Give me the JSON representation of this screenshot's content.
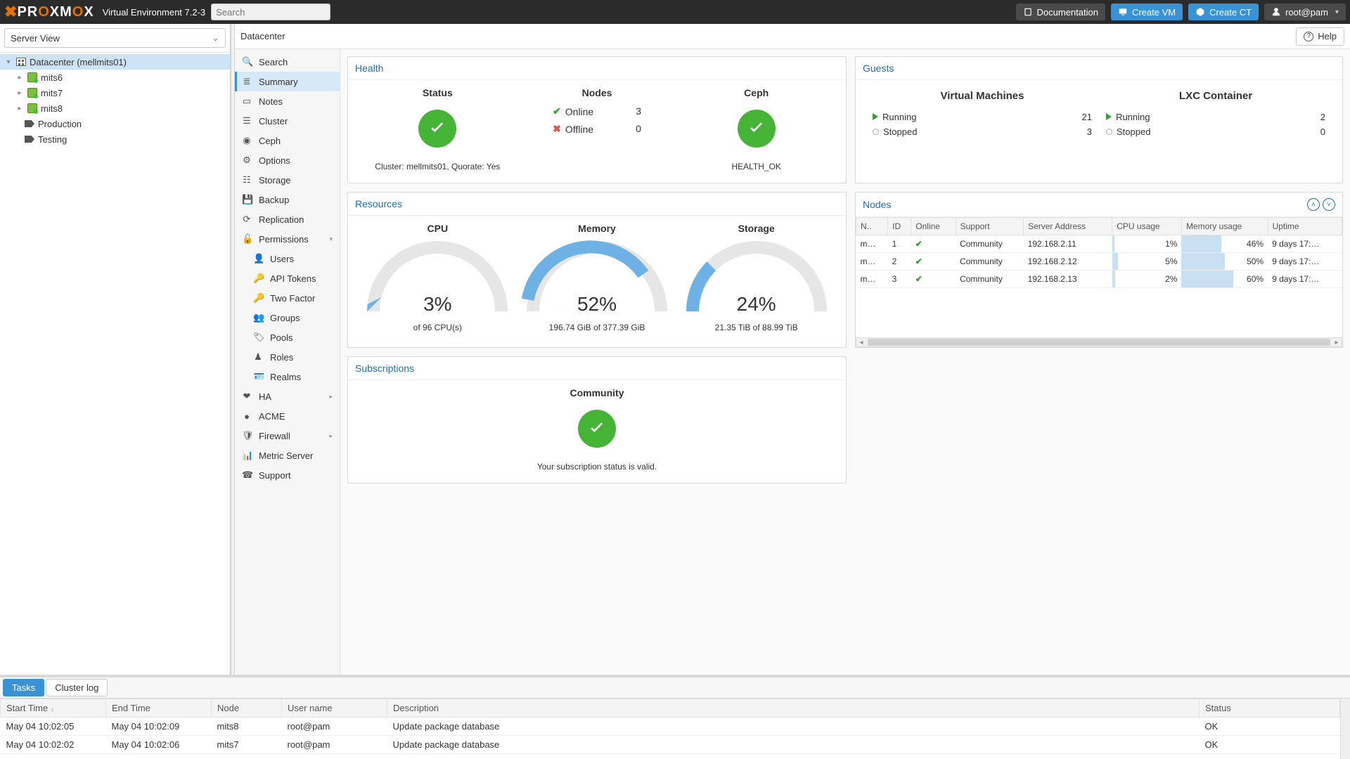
{
  "app": {
    "product": "PROXMOX",
    "subtitle": "Virtual Environment 7.2-3"
  },
  "search": {
    "placeholder": "Search"
  },
  "topbar": {
    "documentation": "Documentation",
    "create_vm": "Create VM",
    "create_ct": "Create CT",
    "user": "root@pam"
  },
  "tree": {
    "view_label": "Server View",
    "root": "Datacenter (mellmits01)",
    "nodes": [
      "mits6",
      "mits7",
      "mits8"
    ],
    "pools": [
      "Production",
      "Testing"
    ]
  },
  "crumb": {
    "title": "Datacenter",
    "help": "Help"
  },
  "menu": {
    "search": "Search",
    "summary": "Summary",
    "notes": "Notes",
    "cluster": "Cluster",
    "ceph": "Ceph",
    "options": "Options",
    "storage": "Storage",
    "backup": "Backup",
    "replication": "Replication",
    "permissions": "Permissions",
    "users": "Users",
    "api_tokens": "API Tokens",
    "two_factor": "Two Factor",
    "groups": "Groups",
    "pools": "Pools",
    "roles": "Roles",
    "realms": "Realms",
    "ha": "HA",
    "acme": "ACME",
    "firewall": "Firewall",
    "metric": "Metric Server",
    "support": "Support"
  },
  "health": {
    "title": "Health",
    "status_h": "Status",
    "nodes_h": "Nodes",
    "ceph_h": "Ceph",
    "cluster_line": "Cluster: mellmits01, Quorate: Yes",
    "online_l": "Online",
    "online_v": "3",
    "offline_l": "Offline",
    "offline_v": "0",
    "ceph_status": "HEALTH_OK"
  },
  "guests": {
    "title": "Guests",
    "vm_h": "Virtual Machines",
    "lxc_h": "LXC Container",
    "running_l": "Running",
    "stopped_l": "Stopped",
    "vm_running": "21",
    "vm_stopped": "3",
    "lxc_running": "2",
    "lxc_stopped": "0"
  },
  "resources": {
    "title": "Resources",
    "cpu_h": "CPU",
    "cpu_v": "3%",
    "cpu_sub": "of 96 CPU(s)",
    "mem_h": "Memory",
    "mem_v": "52%",
    "mem_sub": "196.74 GiB of 377.39 GiB",
    "sto_h": "Storage",
    "sto_v": "24%",
    "sto_sub": "21.35 TiB of 88.99 TiB"
  },
  "nodes_panel": {
    "title": "Nodes",
    "cols": {
      "name": "N..",
      "id": "ID",
      "online": "Online",
      "support": "Support",
      "addr": "Server Address",
      "cpu": "CPU usage",
      "mem": "Memory usage",
      "uptime": "Uptime"
    },
    "rows": [
      {
        "name": "m…",
        "id": "1",
        "support": "Community",
        "addr": "192.168.2.11",
        "cpu": "1%",
        "cpu_p": 3,
        "mem": "46%",
        "mem_p": 46,
        "uptime": "9 days 17:…"
      },
      {
        "name": "m…",
        "id": "2",
        "support": "Community",
        "addr": "192.168.2.12",
        "cpu": "5%",
        "cpu_p": 8,
        "mem": "50%",
        "mem_p": 50,
        "uptime": "9 days 17:…"
      },
      {
        "name": "m…",
        "id": "3",
        "support": "Community",
        "addr": "192.168.2.13",
        "cpu": "2%",
        "cpu_p": 4,
        "mem": "60%",
        "mem_p": 60,
        "uptime": "9 days 17:…"
      }
    ]
  },
  "subs": {
    "title": "Subscriptions",
    "level": "Community",
    "msg": "Your subscription status is valid."
  },
  "log": {
    "tabs": {
      "tasks": "Tasks",
      "cluster": "Cluster log"
    },
    "cols": {
      "start": "Start Time",
      "end": "End Time",
      "node": "Node",
      "user": "User name",
      "desc": "Description",
      "status": "Status"
    },
    "rows": [
      {
        "start": "May 04 10:02:05",
        "end": "May 04 10:02:09",
        "node": "mits8",
        "user": "root@pam",
        "desc": "Update package database",
        "status": "OK"
      },
      {
        "start": "May 04 10:02:02",
        "end": "May 04 10:02:06",
        "node": "mits7",
        "user": "root@pam",
        "desc": "Update package database",
        "status": "OK"
      }
    ]
  },
  "chart_data": [
    {
      "type": "bar",
      "title": "CPU",
      "categories": [
        "CPU"
      ],
      "values": [
        3
      ],
      "ylim": [
        0,
        100
      ],
      "ylabel": "% of 96 CPU(s)"
    },
    {
      "type": "bar",
      "title": "Memory",
      "categories": [
        "Memory"
      ],
      "values": [
        52
      ],
      "ylim": [
        0,
        100
      ],
      "ylabel": "% (196.74/377.39 GiB)"
    },
    {
      "type": "bar",
      "title": "Storage",
      "categories": [
        "Storage"
      ],
      "values": [
        24
      ],
      "ylim": [
        0,
        100
      ],
      "ylabel": "% (21.35/88.99 TiB)"
    },
    {
      "type": "bar",
      "title": "Node CPU usage",
      "categories": [
        "mits6",
        "mits7",
        "mits8"
      ],
      "values": [
        1,
        5,
        2
      ],
      "ylim": [
        0,
        100
      ],
      "ylabel": "%"
    },
    {
      "type": "bar",
      "title": "Node Memory usage",
      "categories": [
        "mits6",
        "mits7",
        "mits8"
      ],
      "values": [
        46,
        50,
        60
      ],
      "ylim": [
        0,
        100
      ],
      "ylabel": "%"
    }
  ]
}
